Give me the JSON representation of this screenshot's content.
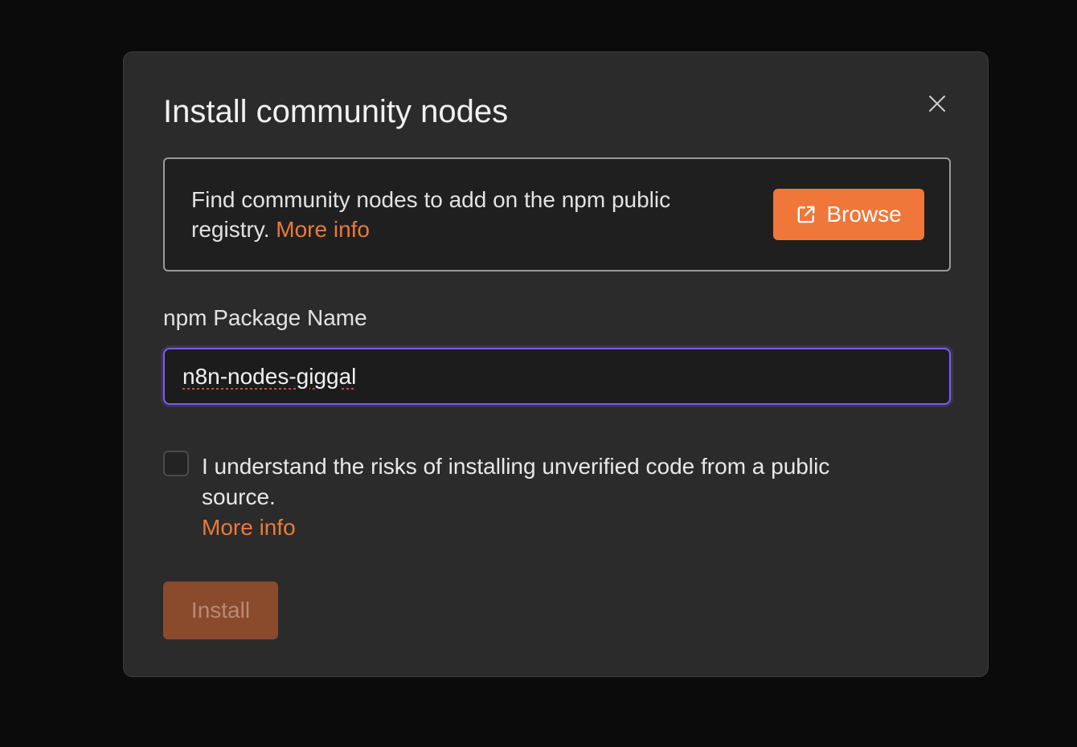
{
  "modal": {
    "title": "Install community nodes"
  },
  "info": {
    "text": "Find community nodes to add on the npm public registry.",
    "more_info": "More info",
    "browse_label": "Browse"
  },
  "package": {
    "label": "npm Package Name",
    "value": "n8n-nodes-giggal"
  },
  "consent": {
    "label": "I understand the risks of installing unverified code from a public source.",
    "more_info": "More info",
    "checked": false
  },
  "actions": {
    "install_label": "Install"
  },
  "colors": {
    "accent": "#ef7739",
    "focus": "#7d5cf0",
    "modal_bg": "#2b2b2b"
  },
  "icons": {
    "close": "close-icon",
    "browse": "external-link-icon"
  }
}
